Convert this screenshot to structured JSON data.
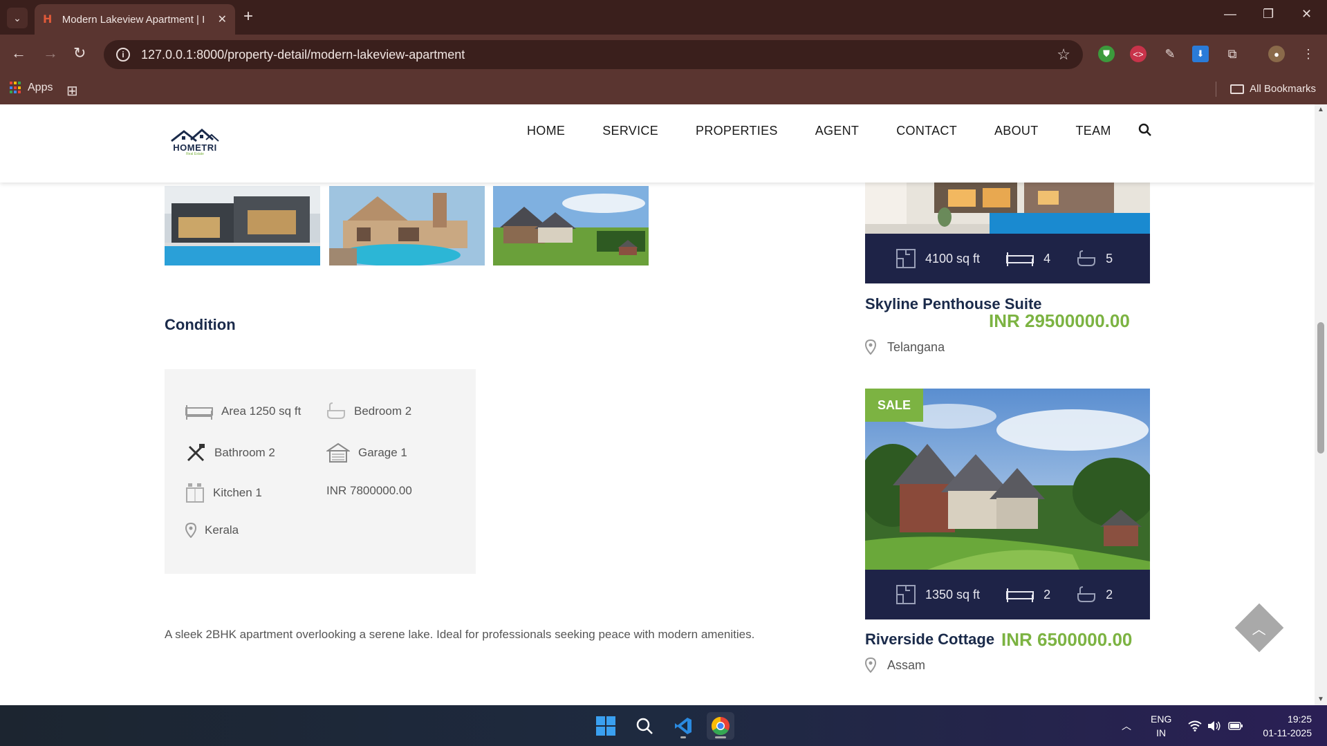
{
  "browser": {
    "tab_title": "Modern Lakeview Apartment | I",
    "url": "127.0.0.1:8000/property-detail/modern-lakeview-apartment",
    "bookmarks": {
      "apps_label": "Apps",
      "all_bookmarks_label": "All Bookmarks"
    }
  },
  "site": {
    "logo_text": "HOMETRI",
    "logo_sub": "Real Estate",
    "nav": [
      "HOME",
      "SERVICE",
      "PROPERTIES",
      "AGENT",
      "CONTACT",
      "ABOUT",
      "TEAM"
    ]
  },
  "condition": {
    "title": "Condition",
    "area": "Area 1250 sq ft",
    "bedroom": "Bedroom 2",
    "bathroom": "Bathroom 2",
    "garage": "Garage 1",
    "kitchen": "Kitchen 1",
    "price": "INR 7800000.00",
    "location": "Kerala"
  },
  "description": "A sleek 2BHK apartment overlooking a serene lake. Ideal for professionals seeking peace with modern amenities.",
  "sidebar": {
    "cards": [
      {
        "area": "4100 sq ft",
        "beds": "4",
        "baths": "5",
        "title": "Skyline Penthouse Suite",
        "price": "INR 29500000.00",
        "location": "Telangana"
      },
      {
        "badge": "SALE",
        "area": "1350 sq ft",
        "beds": "2",
        "baths": "2",
        "title": "Riverside Cottage",
        "price": "INR 6500000.00",
        "location": "Assam"
      }
    ]
  },
  "taskbar": {
    "lang_line1": "ENG",
    "lang_line2": "IN",
    "time": "19:25",
    "date": "01-11-2025"
  },
  "colors": {
    "brand_green": "#7cb342",
    "navy": "#1e2347",
    "chrome_dark": "#3a1f1c",
    "chrome_mid": "#5a3530"
  }
}
